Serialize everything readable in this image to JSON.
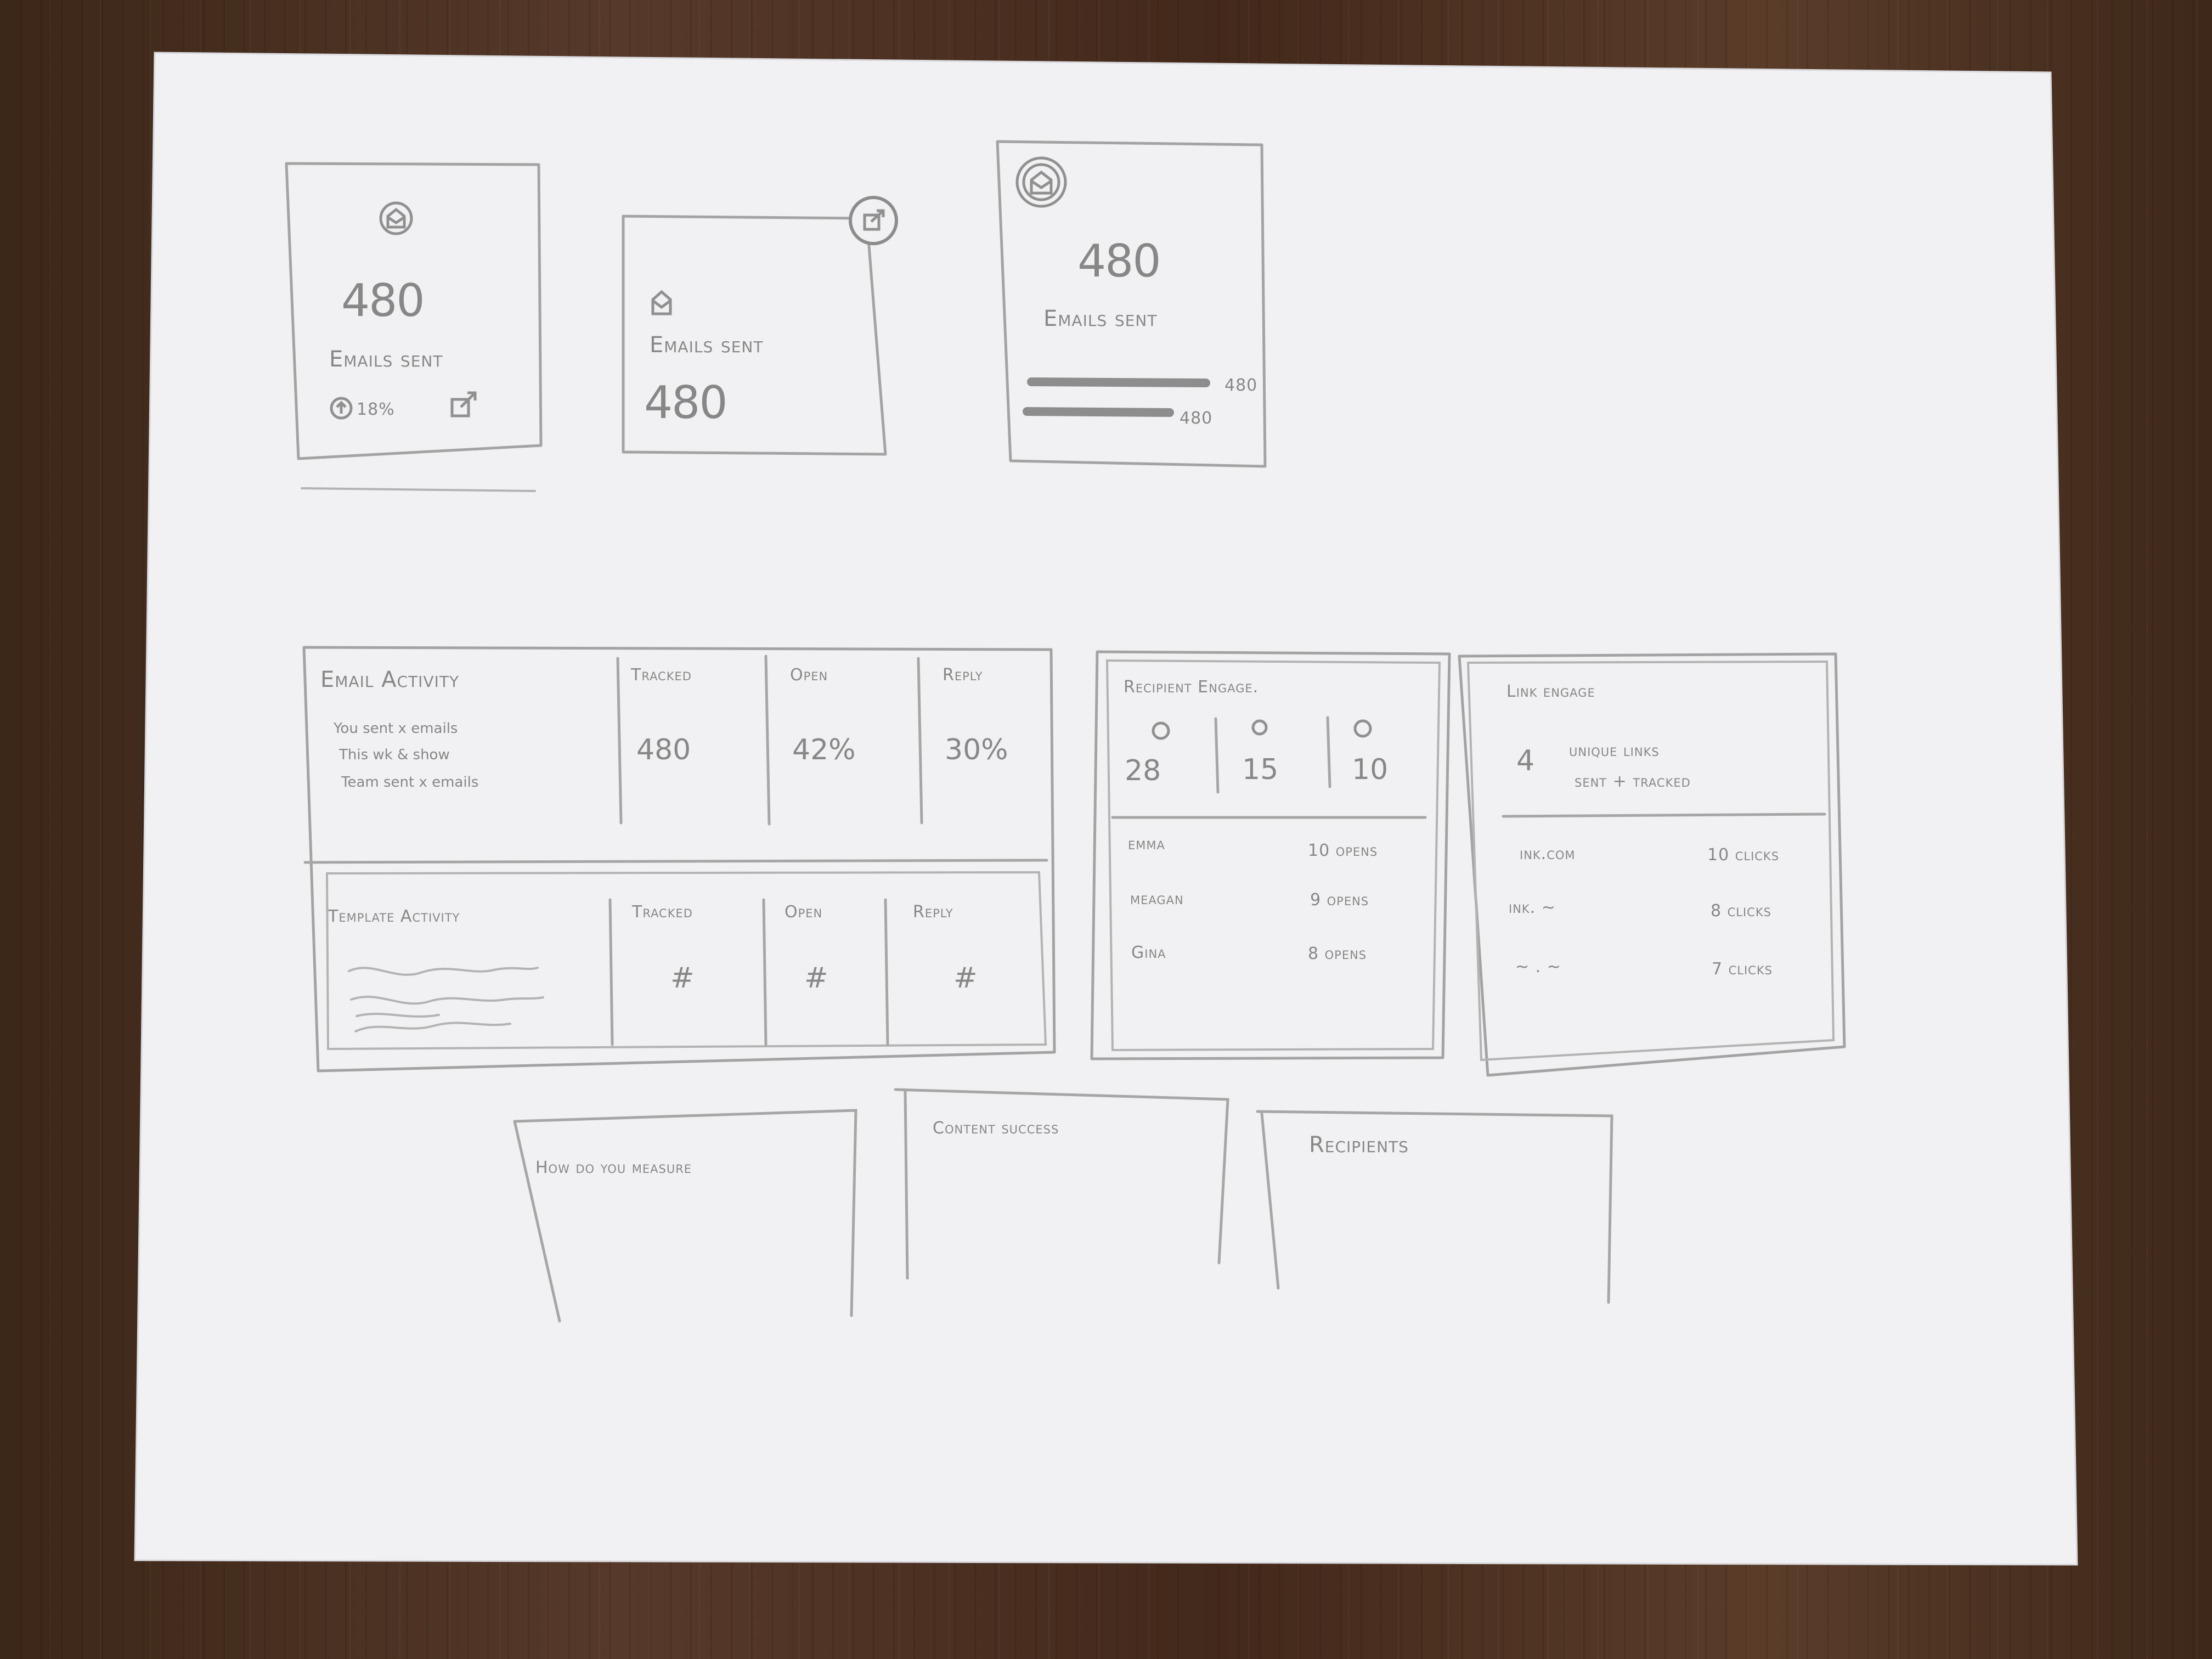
{
  "cards": {
    "card1": {
      "icon": "email-icon",
      "value": "480",
      "label": "Emails sent",
      "delta": "18%",
      "link_icon": "external-link-icon"
    },
    "card2": {
      "icon": "email-icon",
      "label": "Emails sent",
      "value": "480",
      "corner_icon": "external-link-icon"
    },
    "card3": {
      "icon": "email-icon",
      "value": "480",
      "label": "Emails sent",
      "bar1_value": "480",
      "bar2_value": "480"
    }
  },
  "email_activity": {
    "title": "Email Activity",
    "desc": [
      "You sent x emails",
      "This wk & show",
      "Team sent x emails"
    ],
    "cols": [
      {
        "label": "Tracked",
        "value": "480"
      },
      {
        "label": "Open",
        "value": "42%"
      },
      {
        "label": "Reply",
        "value": "30%"
      }
    ]
  },
  "template_activity": {
    "title": "Template Activity",
    "cols": [
      {
        "label": "Tracked",
        "value": "#"
      },
      {
        "label": "Open",
        "value": "#"
      },
      {
        "label": "Reply",
        "value": "#"
      }
    ]
  },
  "recipient_engage": {
    "title": "Recipient Engage.",
    "stats": [
      "28",
      "15",
      "10"
    ],
    "rows": [
      {
        "name": "emma",
        "value": "10 opens"
      },
      {
        "name": "meagan",
        "value": "9 opens"
      },
      {
        "name": "Gina",
        "value": "8 opens"
      }
    ]
  },
  "link_engage": {
    "title": "Link engage",
    "headline_num": "4",
    "headline_l1": "unique links",
    "headline_l2": "sent + tracked",
    "rows": [
      {
        "name": "ink.com",
        "value": "10 clicks"
      },
      {
        "name": "ink. ~",
        "value": "8 clicks"
      },
      {
        "name": "~ . ~",
        "value": "7 clicks"
      }
    ]
  },
  "bottom": {
    "how": "How do you measure",
    "content": "Content success",
    "recipients": "Recipients"
  },
  "colors": {
    "paper": "#f1f1f3",
    "pencil": "#8a8a8a",
    "wood": "#4a3120"
  }
}
